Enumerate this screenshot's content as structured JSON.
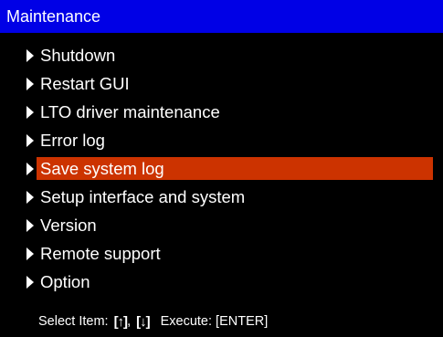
{
  "window": {
    "title": "Maintenance",
    "title_bar_color": "#0000e6",
    "background_color": "#000000",
    "selection_color": "#cc3300"
  },
  "menu": {
    "items": [
      {
        "label": "Shutdown",
        "icon": "triangle-right-icon",
        "selected": false
      },
      {
        "label": "Restart GUI",
        "icon": "triangle-right-icon",
        "selected": false
      },
      {
        "label": "LTO driver maintenance",
        "icon": "triangle-right-icon",
        "selected": false
      },
      {
        "label": "Error log",
        "icon": "triangle-right-icon",
        "selected": false
      },
      {
        "label": "Save system log",
        "icon": "triangle-right-icon",
        "selected": true
      },
      {
        "label": "Setup interface and system",
        "icon": "triangle-right-icon",
        "selected": false
      },
      {
        "label": "Version",
        "icon": "triangle-right-icon",
        "selected": false
      },
      {
        "label": "Remote support",
        "icon": "triangle-right-icon",
        "selected": false
      },
      {
        "label": "Option",
        "icon": "triangle-right-icon",
        "selected": false
      }
    ]
  },
  "footer": {
    "select_label": "Select Item:",
    "up_key": "[↑]",
    "separator": ",",
    "down_key": "[↓]",
    "execute_label": "Execute: [ENTER]"
  }
}
